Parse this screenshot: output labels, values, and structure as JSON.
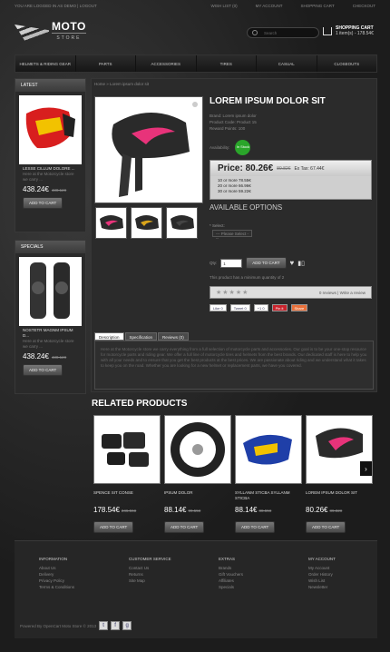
{
  "topbar": {
    "login": "YOU ARE LOGGED IN AS DEMO | LOGOUT",
    "links": [
      "WISH LIST (0)",
      "MY ACCOUNT",
      "SHOPPING CART",
      "CHECKOUT"
    ]
  },
  "logo": {
    "main": "MOTO",
    "sub": "STORE"
  },
  "search": {
    "placeholder": "Search"
  },
  "cart": {
    "title": "SHOPPING CART",
    "summary": "1 item(s) - 178.54€"
  },
  "nav": [
    "HELMETS & RIDING GEAR",
    "PARTS",
    "ACCESSORIES",
    "TIRES",
    "CASUAL",
    "CLOSEOUTS"
  ],
  "latest": {
    "title": "LATEST",
    "name": "LESSE CILLUM DOLORE ...",
    "desc": "Here at the Motorcycle store we carry ...",
    "price": "438.24€",
    "old": "438.12€",
    "btn": "ADD TO CART"
  },
  "specials": {
    "title": "SPECIALS",
    "name": "NOSTETR MAGNM IPSUM D...",
    "desc": "Here at the Motorcycle store we carry ...",
    "price": "438.24€",
    "old": "438.12€",
    "btn": "ADD TO CART"
  },
  "crumb": "Home » Lorem ipsum dolor sit",
  "product": {
    "title": "LOREM IPSUM DOLOR SIT",
    "brand": "Brand: Lorem ipsum dolor",
    "code": "Product Code: Product 15",
    "points": "Reward Points: 100",
    "avail": "Availability:",
    "stock": "In Stock",
    "price": "Price: 80.26€",
    "old": "89.82€",
    "extax": "Ex Tax: 67.44€",
    "discounts": [
      "10 or more 78.55€",
      "20 or more 66.96€",
      "30 or more 59.22€"
    ],
    "options": "AVAILABLE OPTIONS",
    "select_label": "* Select:",
    "select_val": "--- Please Select ---",
    "qty": "Qty:",
    "qty_val": "1",
    "addbtn": "ADD TO CART",
    "minqty": "This product has a minimum quantity of 2",
    "reviews": "0 reviews | Write a review"
  },
  "social": [
    "Like 0",
    "Tweet 0",
    "+1 0",
    "Pin it",
    "Share"
  ],
  "tabs": [
    "Description",
    "Specification",
    "Reviews (0)"
  ],
  "description": "Here at the Motorcycle store we carry everything from a full selection of motorcycle parts and accessories. Our goal is to be your one-stop resource for motorcycle parts and riding gear. We offer a full line of motorcycle tires and helmets from the best brands. Our dedicated staff is here to help you with all your needs and to ensure that you get the best products at the best prices. We are passionate about riding and we understand what it takes to keep you on the road. Whether you are looking for a new helmet or replacement parts, we have you covered.",
  "related": {
    "title": "RELATED PRODUCTS",
    "items": [
      {
        "name": "SPENCE SIT CONSE",
        "price": "178.54€",
        "old": "246.56€"
      },
      {
        "name": "IPSUM DOLOR",
        "price": "88.14€",
        "old": "99.55€"
      },
      {
        "name": "SYLLANM STICBA SYLLANM STICBA",
        "price": "88.14€",
        "old": "88.55€"
      },
      {
        "name": "LOREM IPSUM DOLOR SIT",
        "price": "80.26€",
        "old": "89.82€"
      }
    ],
    "btn": "ADD TO CART"
  },
  "footer": {
    "cols": [
      {
        "h": "INFORMATION",
        "l": [
          "About Us",
          "Delivery",
          "Privacy Policy",
          "Terms & Conditions"
        ]
      },
      {
        "h": "CUSTOMER SERVICE",
        "l": [
          "Contact Us",
          "Returns",
          "Site Map"
        ]
      },
      {
        "h": "EXTRAS",
        "l": [
          "Brands",
          "Gift Vouchers",
          "Affiliates",
          "Specials"
        ]
      },
      {
        "h": "MY ACCOUNT",
        "l": [
          "My Account",
          "Order History",
          "Wish List",
          "Newsletter"
        ]
      }
    ],
    "copy": "Powered By OpenCart Moto Store © 2013"
  }
}
